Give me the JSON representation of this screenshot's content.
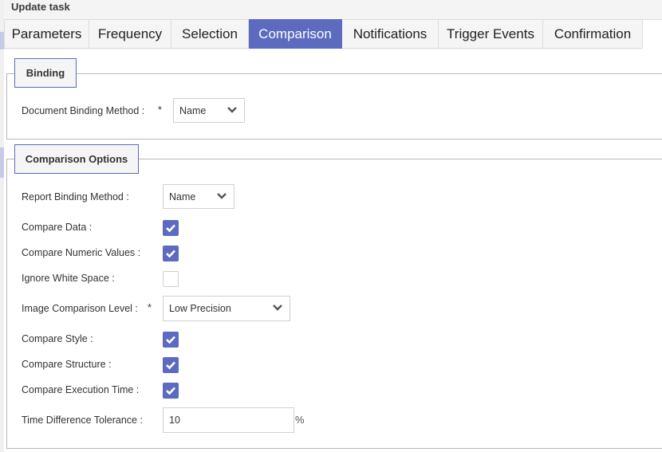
{
  "window": {
    "title": "Update task"
  },
  "tabs": [
    {
      "label": "Parameters",
      "active": false
    },
    {
      "label": "Frequency",
      "active": false
    },
    {
      "label": "Selection",
      "active": false
    },
    {
      "label": "Comparison",
      "active": true
    },
    {
      "label": "Notifications",
      "active": false
    },
    {
      "label": "Trigger Events",
      "active": false
    },
    {
      "label": "Confirmation",
      "active": false
    }
  ],
  "binding": {
    "legend": "Binding",
    "document_binding_method": {
      "label": "Document Binding Method :",
      "required": "*",
      "value": "Name"
    }
  },
  "comparison_options": {
    "legend": "Comparison Options",
    "report_binding_method": {
      "label": "Report Binding Method :",
      "value": "Name"
    },
    "compare_data": {
      "label": "Compare Data :",
      "checked": true
    },
    "compare_numeric_values": {
      "label": "Compare Numeric Values :",
      "checked": true
    },
    "ignore_white_space": {
      "label": "Ignore White Space :",
      "checked": false
    },
    "image_comparison_level": {
      "label": "Image Comparison Level :",
      "required": "*",
      "value": "Low Precision"
    },
    "compare_style": {
      "label": "Compare Style :",
      "checked": true
    },
    "compare_structure": {
      "label": "Compare Structure :",
      "checked": true
    },
    "compare_execution_time": {
      "label": "Compare Execution Time :",
      "checked": true
    },
    "time_difference_tolerance": {
      "label": "Time Difference Tolerance :",
      "value": "10",
      "unit": "%"
    }
  },
  "colors": {
    "accent": "#5c6bc0",
    "border": "#b8b8b8",
    "tab_bg": "#f5f5f5"
  }
}
